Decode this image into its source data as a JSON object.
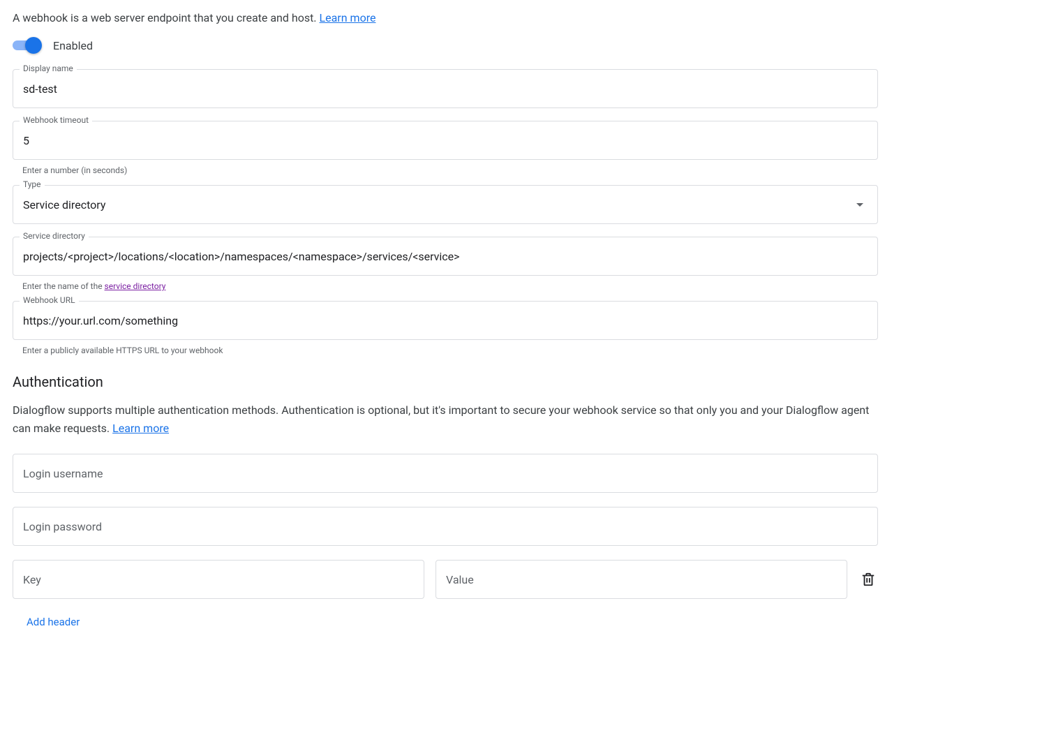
{
  "intro": {
    "text": "A webhook is a web server endpoint that you create and host. ",
    "link": "Learn more"
  },
  "toggle": {
    "label": "Enabled",
    "on": true
  },
  "fields": {
    "display_name": {
      "label": "Display name",
      "value": "sd-test"
    },
    "timeout": {
      "label": "Webhook timeout",
      "value": "5",
      "helper": "Enter a number (in seconds)"
    },
    "type": {
      "label": "Type",
      "value": "Service directory"
    },
    "service_dir": {
      "label": "Service directory",
      "value": "projects/<project>/locations/<location>/namespaces/<namespace>/services/<service>",
      "helper_prefix": "Enter the name of the ",
      "helper_link": "service directory"
    },
    "url": {
      "label": "Webhook URL",
      "value": "https://your.url.com/something",
      "helper": "Enter a publicly available HTTPS URL to your webhook"
    }
  },
  "auth": {
    "heading": "Authentication",
    "desc": "Dialogflow supports multiple authentication methods. Authentication is optional, but it's important to secure your webhook service so that only you and your Dialogflow agent can make requests. ",
    "link": "Learn more",
    "username_placeholder": "Login username",
    "password_placeholder": "Login password",
    "key_placeholder": "Key",
    "value_placeholder": "Value",
    "add_header": "Add header"
  }
}
